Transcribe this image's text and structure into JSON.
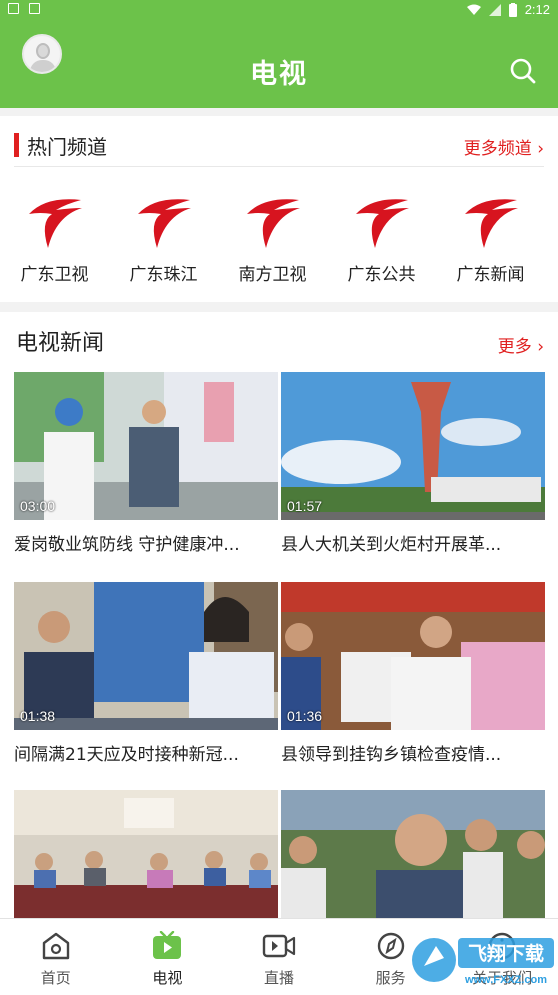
{
  "statusbar": {
    "time": "2:12"
  },
  "header": {
    "title": "电视"
  },
  "hot_channels": {
    "title": "热门频道",
    "more": "更多频道 ›",
    "items": [
      {
        "name": "广东卫视"
      },
      {
        "name": "广东珠江"
      },
      {
        "name": "南方卫视"
      },
      {
        "name": "广东公共"
      },
      {
        "name": "广东新闻"
      }
    ]
  },
  "tv_news": {
    "title": "电视新闻",
    "more": "更多 ›",
    "videos": [
      {
        "duration": "03:00",
        "caption": "爱岗敬业筑防线 守护健康冲..."
      },
      {
        "duration": "01:57",
        "caption": "县人大机关到火炬村开展革..."
      },
      {
        "duration": "01:38",
        "caption": "间隔满21天应及时接种新冠..."
      },
      {
        "duration": "01:36",
        "caption": "县领导到挂钩乡镇检查疫情..."
      },
      {
        "duration": "",
        "caption": ""
      },
      {
        "duration": "",
        "caption": ""
      }
    ]
  },
  "tabbar": {
    "tabs": [
      {
        "label": "首页",
        "icon": "home-icon"
      },
      {
        "label": "电视",
        "icon": "tv-icon"
      },
      {
        "label": "直播",
        "icon": "live-video-icon"
      },
      {
        "label": "服务",
        "icon": "service-icon"
      },
      {
        "label": "关于我们",
        "icon": "about-icon"
      }
    ]
  },
  "watermark": {
    "text": "飞翔下载",
    "url": "www.FXXZ.com"
  },
  "colors": {
    "brand_green": "#6cc24a",
    "accent_red": "#e02020",
    "logo_red": "#d7141f"
  }
}
